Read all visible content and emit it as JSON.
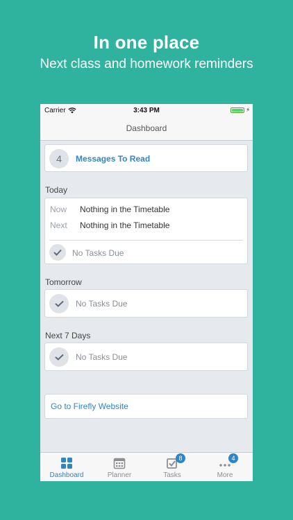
{
  "promo": {
    "headline": "In one place",
    "subheadline": "Next class and homework reminders"
  },
  "status_bar": {
    "carrier": "Carrier",
    "time": "3:43 PM"
  },
  "nav": {
    "title": "Dashboard"
  },
  "messages": {
    "count": "4",
    "label": "Messages To Read"
  },
  "today": {
    "heading": "Today",
    "now_label": "Now",
    "now_value": "Nothing in the Timetable",
    "next_label": "Next",
    "next_value": "Nothing in the Timetable",
    "tasks": "No Tasks Due"
  },
  "tomorrow": {
    "heading": "Tomorrow",
    "tasks": "No Tasks Due"
  },
  "next7": {
    "heading": "Next 7 Days",
    "tasks": "No Tasks Due"
  },
  "website_link": "Go to Firefly Website",
  "tabs": [
    {
      "label": "Dashboard",
      "icon": "dashboard-grid-icon",
      "active": true
    },
    {
      "label": "Planner",
      "icon": "calendar-icon"
    },
    {
      "label": "Tasks",
      "icon": "tasks-check-icon",
      "badge": "8"
    },
    {
      "label": "More",
      "icon": "more-dots-icon",
      "badge": "4"
    }
  ],
  "colors": {
    "background": "#2fb39f",
    "accent": "#2f86c7",
    "screen_bg": "#e6e9ed"
  }
}
